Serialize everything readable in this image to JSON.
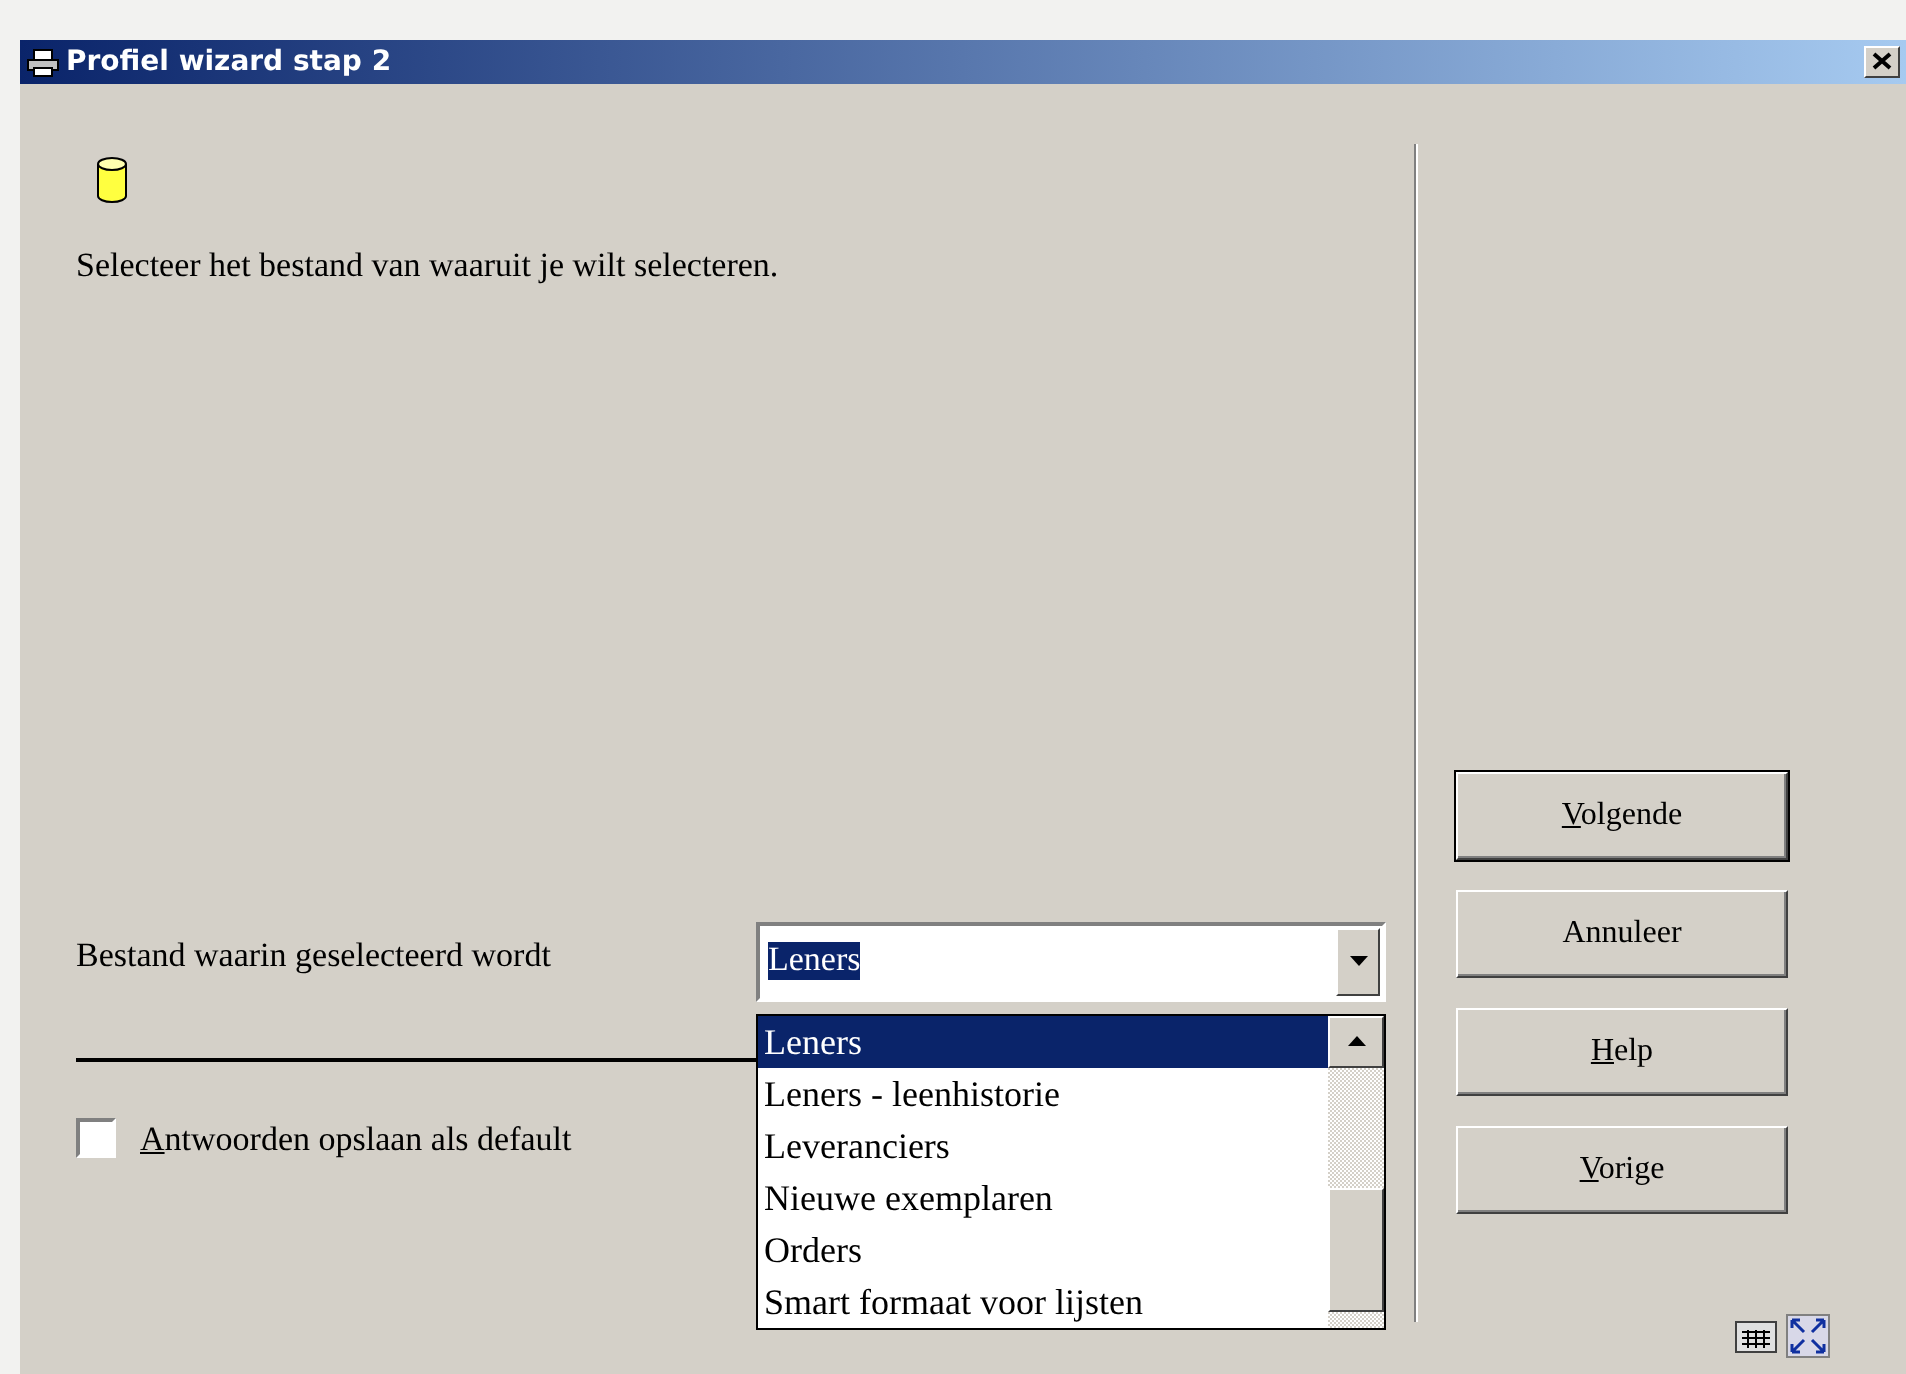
{
  "window": {
    "title": "Profiel wizard stap 2"
  },
  "instruction": "Selecteer het bestand van waaruit je wilt selecteren.",
  "file_field": {
    "label": "Bestand waarin geselecteerd wordt",
    "value": "Leners",
    "expanded": true
  },
  "dropdown": [
    {
      "label": "Leners",
      "selected": true
    },
    {
      "label": "Leners - leenhistorie",
      "selected": false
    },
    {
      "label": "Leveranciers",
      "selected": false
    },
    {
      "label": "Nieuwe exemplaren",
      "selected": false
    },
    {
      "label": "Orders",
      "selected": false
    },
    {
      "label": "Smart formaat voor lijsten",
      "selected": false
    }
  ],
  "save_default": {
    "label": "Antwoorden opslaan als default",
    "checked": false,
    "underline_first": true
  },
  "buttons": [
    {
      "label": "Volgende",
      "default": true,
      "underline_first": true
    },
    {
      "label": "Annuleer",
      "default": false,
      "underline_first": false
    },
    {
      "label": "Help",
      "default": false,
      "underline_first": true
    },
    {
      "label": "Vorige",
      "default": false,
      "underline_first": true
    }
  ]
}
